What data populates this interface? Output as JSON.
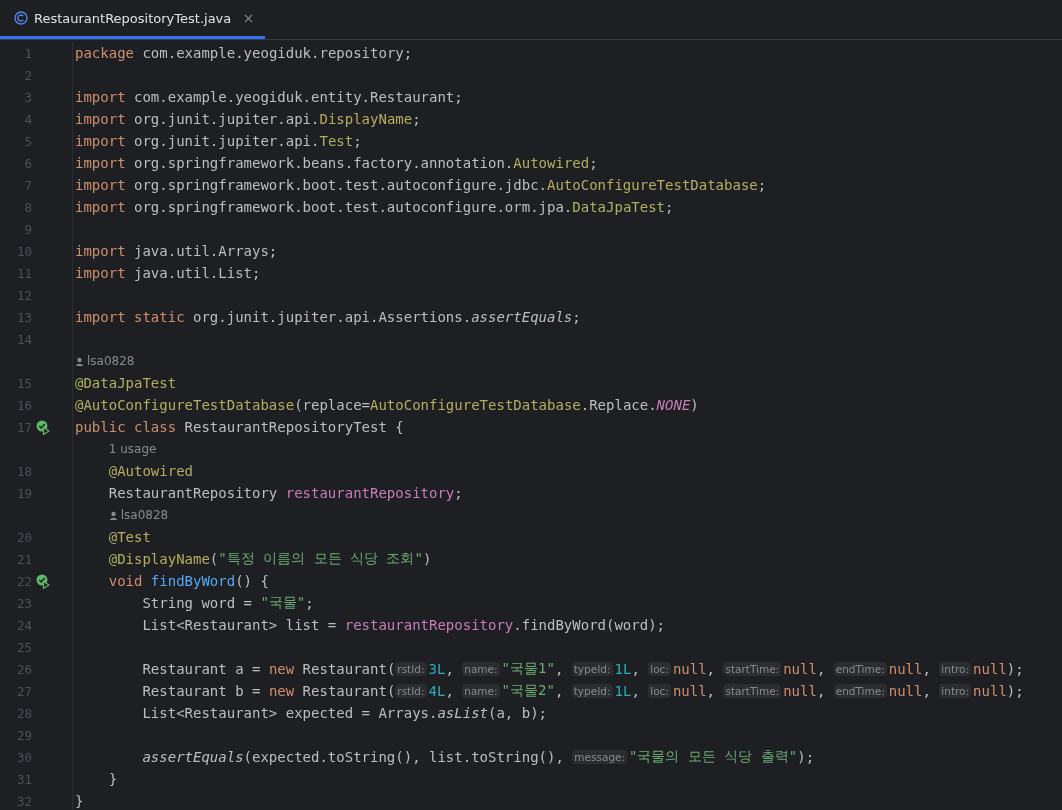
{
  "tabs": [
    {
      "label": "RestaurantRepositoryTest.java",
      "selected": true
    }
  ],
  "lines": [
    {
      "kind": "code",
      "number": "1",
      "tokens": [
        {
          "text": "package",
          "kind": "kw"
        },
        {
          "text": " com.example.yeogiduk.repository;",
          "kind": "plain"
        }
      ]
    },
    {
      "kind": "code",
      "number": "2"
    },
    {
      "kind": "code",
      "number": "3",
      "tokens": [
        {
          "text": "import",
          "kind": "kw"
        },
        {
          "text": " com.example.yeogiduk.entity.Restaurant;",
          "kind": "plain"
        }
      ]
    },
    {
      "kind": "code",
      "number": "4",
      "tokens": [
        {
          "text": "import",
          "kind": "kw"
        },
        {
          "text": " org.junit.jupiter.api.",
          "kind": "plain"
        },
        {
          "text": "DisplayName",
          "kind": "ann"
        },
        {
          "text": ";",
          "kind": "plain"
        }
      ]
    },
    {
      "kind": "code",
      "number": "5",
      "tokens": [
        {
          "text": "import",
          "kind": "kw"
        },
        {
          "text": " org.junit.jupiter.api.",
          "kind": "plain"
        },
        {
          "text": "Test",
          "kind": "ann"
        },
        {
          "text": ";",
          "kind": "plain"
        }
      ]
    },
    {
      "kind": "code",
      "number": "6",
      "tokens": [
        {
          "text": "import",
          "kind": "kw"
        },
        {
          "text": " org.springframework.beans.factory.annotation.",
          "kind": "plain"
        },
        {
          "text": "Autowired",
          "kind": "ann"
        },
        {
          "text": ";",
          "kind": "plain"
        }
      ]
    },
    {
      "kind": "code",
      "number": "7",
      "tokens": [
        {
          "text": "import",
          "kind": "kw"
        },
        {
          "text": " org.springframework.boot.test.autoconfigure.jdbc.",
          "kind": "plain"
        },
        {
          "text": "AutoConfigureTestDatabase",
          "kind": "ann"
        },
        {
          "text": ";",
          "kind": "plain"
        }
      ]
    },
    {
      "kind": "code",
      "number": "8",
      "tokens": [
        {
          "text": "import",
          "kind": "kw"
        },
        {
          "text": " org.springframework.boot.test.autoconfigure.orm.jpa.",
          "kind": "plain"
        },
        {
          "text": "DataJpaTest",
          "kind": "ann"
        },
        {
          "text": ";",
          "kind": "plain"
        }
      ]
    },
    {
      "kind": "code",
      "number": "9"
    },
    {
      "kind": "code",
      "number": "10",
      "tokens": [
        {
          "text": "import",
          "kind": "kw"
        },
        {
          "text": " java.util.Arrays;",
          "kind": "plain"
        }
      ]
    },
    {
      "kind": "code",
      "number": "11",
      "tokens": [
        {
          "text": "import",
          "kind": "kw"
        },
        {
          "text": " java.util.List;",
          "kind": "plain"
        }
      ]
    },
    {
      "kind": "code",
      "number": "12"
    },
    {
      "kind": "code",
      "number": "13",
      "tokens": [
        {
          "text": "import static",
          "kind": "kw"
        },
        {
          "text": " org.junit.jupiter.api.Assertions.",
          "kind": "plain"
        },
        {
          "text": "assertEquals",
          "kind": "italic"
        },
        {
          "text": ";",
          "kind": "plain"
        }
      ]
    },
    {
      "kind": "code",
      "number": "14"
    },
    {
      "kind": "author",
      "text": "lsa0828"
    },
    {
      "kind": "code",
      "number": "15",
      "tokens": [
        {
          "text": "@DataJpaTest",
          "kind": "ann"
        }
      ]
    },
    {
      "kind": "code",
      "number": "16",
      "tokens": [
        {
          "text": "@AutoConfigureTestDatabase",
          "kind": "ann"
        },
        {
          "text": "(replace=",
          "kind": "plain"
        },
        {
          "text": "AutoConfigureTestDatabase",
          "kind": "ann"
        },
        {
          "text": ".Replace.",
          "kind": "plain"
        },
        {
          "text": "NONE",
          "kind": "const"
        },
        {
          "text": ")",
          "kind": "plain"
        }
      ]
    },
    {
      "kind": "code",
      "number": "17",
      "run_marker": true,
      "tokens": [
        {
          "text": "public class",
          "kind": "kw"
        },
        {
          "text": " RestaurantRepositoryTest {",
          "kind": "plain"
        }
      ]
    },
    {
      "kind": "usage",
      "text": "1 usage"
    },
    {
      "kind": "code",
      "number": "18",
      "tokens": [
        {
          "text": "    @Autowired",
          "kind": "ann"
        }
      ]
    },
    {
      "kind": "code",
      "number": "19",
      "tokens": [
        {
          "text": "    RestaurantRepository ",
          "kind": "plain"
        },
        {
          "text": "restaurantRepository",
          "kind": "field"
        },
        {
          "text": ";",
          "kind": "plain"
        }
      ]
    },
    {
      "kind": "author",
      "text": "lsa0828"
    },
    {
      "kind": "code",
      "number": "20",
      "tokens": [
        {
          "text": "    @Test",
          "kind": "ann"
        }
      ]
    },
    {
      "kind": "code",
      "number": "21",
      "tokens": [
        {
          "text": "    @DisplayName",
          "kind": "ann"
        },
        {
          "text": "(",
          "kind": "plain"
        },
        {
          "text": "\"특정 이름의 모든 식당 조회\"",
          "kind": "str"
        },
        {
          "text": ")",
          "kind": "plain"
        }
      ]
    },
    {
      "kind": "code",
      "number": "22",
      "run_marker": true,
      "tokens": [
        {
          "text": "    void",
          "kind": "kw"
        },
        {
          "text": " findByWord",
          "kind": "fn"
        },
        {
          "text": "() {",
          "kind": "plain"
        }
      ]
    },
    {
      "kind": "code",
      "number": "23",
      "tokens": [
        {
          "text": "        String word = ",
          "kind": "plain"
        },
        {
          "text": "\"국물\"",
          "kind": "str"
        },
        {
          "text": ";",
          "kind": "plain"
        }
      ]
    },
    {
      "kind": "code",
      "number": "24",
      "tokens": [
        {
          "text": "        List<Restaurant> list = ",
          "kind": "plain"
        },
        {
          "text": "restaurantRepository",
          "kind": "field"
        },
        {
          "text": ".findByWord(word);",
          "kind": "plain"
        }
      ]
    },
    {
      "kind": "code",
      "number": "25"
    },
    {
      "kind": "code",
      "number": "26",
      "tokens": [
        {
          "text": "        Restaurant a = ",
          "kind": "plain"
        },
        {
          "text": "new",
          "kind": "kw"
        },
        {
          "text": " Restaurant(",
          "kind": "plain"
        },
        {
          "text": "rstId:",
          "kind": "hint"
        },
        {
          "text": "3L",
          "kind": "num"
        },
        {
          "text": ", ",
          "kind": "plain"
        },
        {
          "text": "name:",
          "kind": "hint"
        },
        {
          "text": "\"국물1\"",
          "kind": "str"
        },
        {
          "text": ", ",
          "kind": "plain"
        },
        {
          "text": "typeId:",
          "kind": "hint"
        },
        {
          "text": "1L",
          "kind": "num"
        },
        {
          "text": ", ",
          "kind": "plain"
        },
        {
          "text": "loc:",
          "kind": "hint"
        },
        {
          "text": "null",
          "kind": "kw"
        },
        {
          "text": ", ",
          "kind": "plain"
        },
        {
          "text": "startTime:",
          "kind": "hint"
        },
        {
          "text": "null",
          "kind": "kw"
        },
        {
          "text": ", ",
          "kind": "plain"
        },
        {
          "text": "endTime:",
          "kind": "hint"
        },
        {
          "text": "null",
          "kind": "kw"
        },
        {
          "text": ", ",
          "kind": "plain"
        },
        {
          "text": "intro:",
          "kind": "hint"
        },
        {
          "text": "null",
          "kind": "kw"
        },
        {
          "text": ");",
          "kind": "plain"
        }
      ]
    },
    {
      "kind": "code",
      "number": "27",
      "tokens": [
        {
          "text": "        Restaurant b = ",
          "kind": "plain"
        },
        {
          "text": "new",
          "kind": "kw"
        },
        {
          "text": " Restaurant(",
          "kind": "plain"
        },
        {
          "text": "rstId:",
          "kind": "hint"
        },
        {
          "text": "4L",
          "kind": "num"
        },
        {
          "text": ", ",
          "kind": "plain"
        },
        {
          "text": "name:",
          "kind": "hint"
        },
        {
          "text": "\"국물2\"",
          "kind": "str"
        },
        {
          "text": ", ",
          "kind": "plain"
        },
        {
          "text": "typeId:",
          "kind": "hint"
        },
        {
          "text": "1L",
          "kind": "num"
        },
        {
          "text": ", ",
          "kind": "plain"
        },
        {
          "text": "loc:",
          "kind": "hint"
        },
        {
          "text": "null",
          "kind": "kw"
        },
        {
          "text": ", ",
          "kind": "plain"
        },
        {
          "text": "startTime:",
          "kind": "hint"
        },
        {
          "text": "null",
          "kind": "kw"
        },
        {
          "text": ", ",
          "kind": "plain"
        },
        {
          "text": "endTime:",
          "kind": "hint"
        },
        {
          "text": "null",
          "kind": "kw"
        },
        {
          "text": ", ",
          "kind": "plain"
        },
        {
          "text": "intro:",
          "kind": "hint"
        },
        {
          "text": "null",
          "kind": "kw"
        },
        {
          "text": ");",
          "kind": "plain"
        }
      ]
    },
    {
      "kind": "code",
      "number": "28",
      "tokens": [
        {
          "text": "        List<Restaurant> expected = Arrays.",
          "kind": "plain"
        },
        {
          "text": "asList",
          "kind": "italic"
        },
        {
          "text": "(a, b);",
          "kind": "plain"
        }
      ]
    },
    {
      "kind": "code",
      "number": "29"
    },
    {
      "kind": "code",
      "number": "30",
      "tokens": [
        {
          "text": "        assertEquals",
          "kind": "italic"
        },
        {
          "text": "(expected.toString(), list.toString(), ",
          "kind": "plain"
        },
        {
          "text": "message:",
          "kind": "hint"
        },
        {
          "text": "\"국물의 모든 식당 출력\"",
          "kind": "str"
        },
        {
          "text": ");",
          "kind": "plain"
        }
      ]
    },
    {
      "kind": "code",
      "number": "31",
      "tokens": [
        {
          "text": "    }",
          "kind": "plain"
        }
      ]
    },
    {
      "kind": "code",
      "number": "32",
      "tokens": [
        {
          "text": "}",
          "kind": "plain"
        }
      ]
    }
  ]
}
